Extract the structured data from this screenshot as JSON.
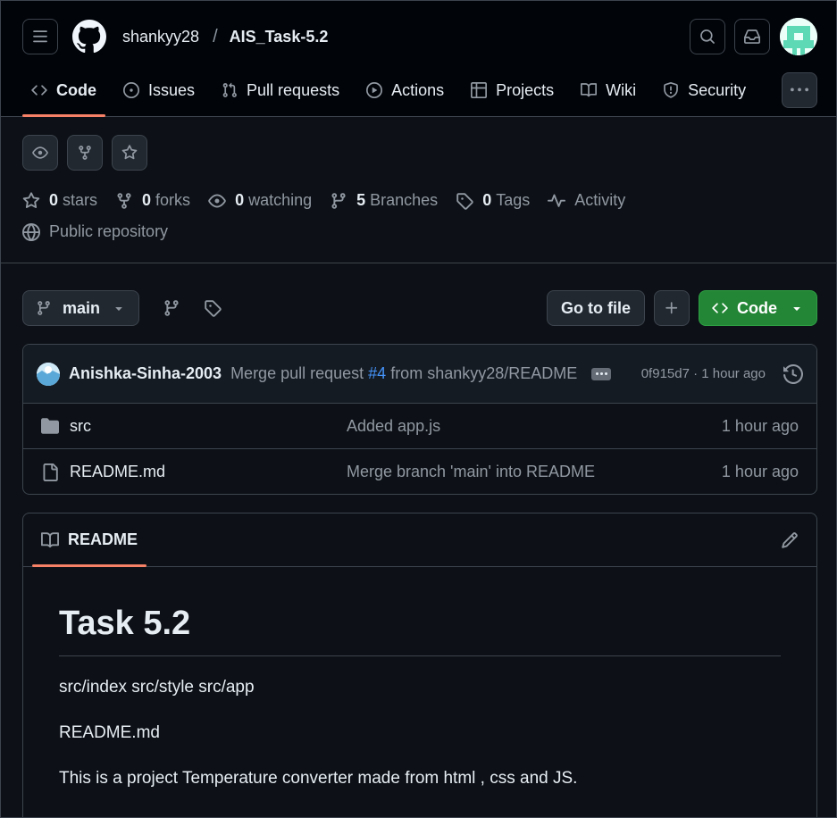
{
  "header": {
    "owner": "shankyy28",
    "separator": "/",
    "repo": "AIS_Task-5.2"
  },
  "tabs": [
    {
      "label": "Code",
      "icon": "code-icon",
      "active": true
    },
    {
      "label": "Issues",
      "icon": "issue-opened-icon"
    },
    {
      "label": "Pull requests",
      "icon": "git-pull-request-icon"
    },
    {
      "label": "Actions",
      "icon": "play-icon"
    },
    {
      "label": "Projects",
      "icon": "table-icon"
    },
    {
      "label": "Wiki",
      "icon": "book-icon"
    },
    {
      "label": "Security",
      "icon": "shield-icon"
    }
  ],
  "stats": {
    "stars_count": "0",
    "stars_label": "stars",
    "forks_count": "0",
    "forks_label": "forks",
    "watching_count": "0",
    "watching_label": "watching",
    "branches_count": "5",
    "branches_label": "Branches",
    "tags_count": "0",
    "tags_label": "Tags",
    "activity_label": "Activity",
    "visibility": "Public repository"
  },
  "branch": {
    "current": "main",
    "goto_file": "Go to file",
    "code_button": "Code"
  },
  "commit": {
    "author": "Anishka-Sinha-2003",
    "message_prefix": "Merge pull request ",
    "pr_link": "#4",
    "message_suffix": " from shankyy28/README",
    "sha_time": "0f915d7 · 1 hour ago"
  },
  "files": [
    {
      "name": "src",
      "type": "folder",
      "message": "Added app.js",
      "time": "1 hour ago"
    },
    {
      "name": "README.md",
      "type": "file",
      "message": "Merge branch 'main' into README",
      "time": "1 hour ago"
    }
  ],
  "readme": {
    "tab_label": "README",
    "title": "Task 5.2",
    "paragraphs": [
      "src/index src/style src/app",
      "README.md",
      "This is a project Temperature converter made from html , css and JS."
    ]
  },
  "colors": {
    "accent_underline": "#f78166",
    "primary_button": "#238636",
    "link": "#4493f8",
    "background": "#0d1117",
    "header_background": "#010409"
  }
}
